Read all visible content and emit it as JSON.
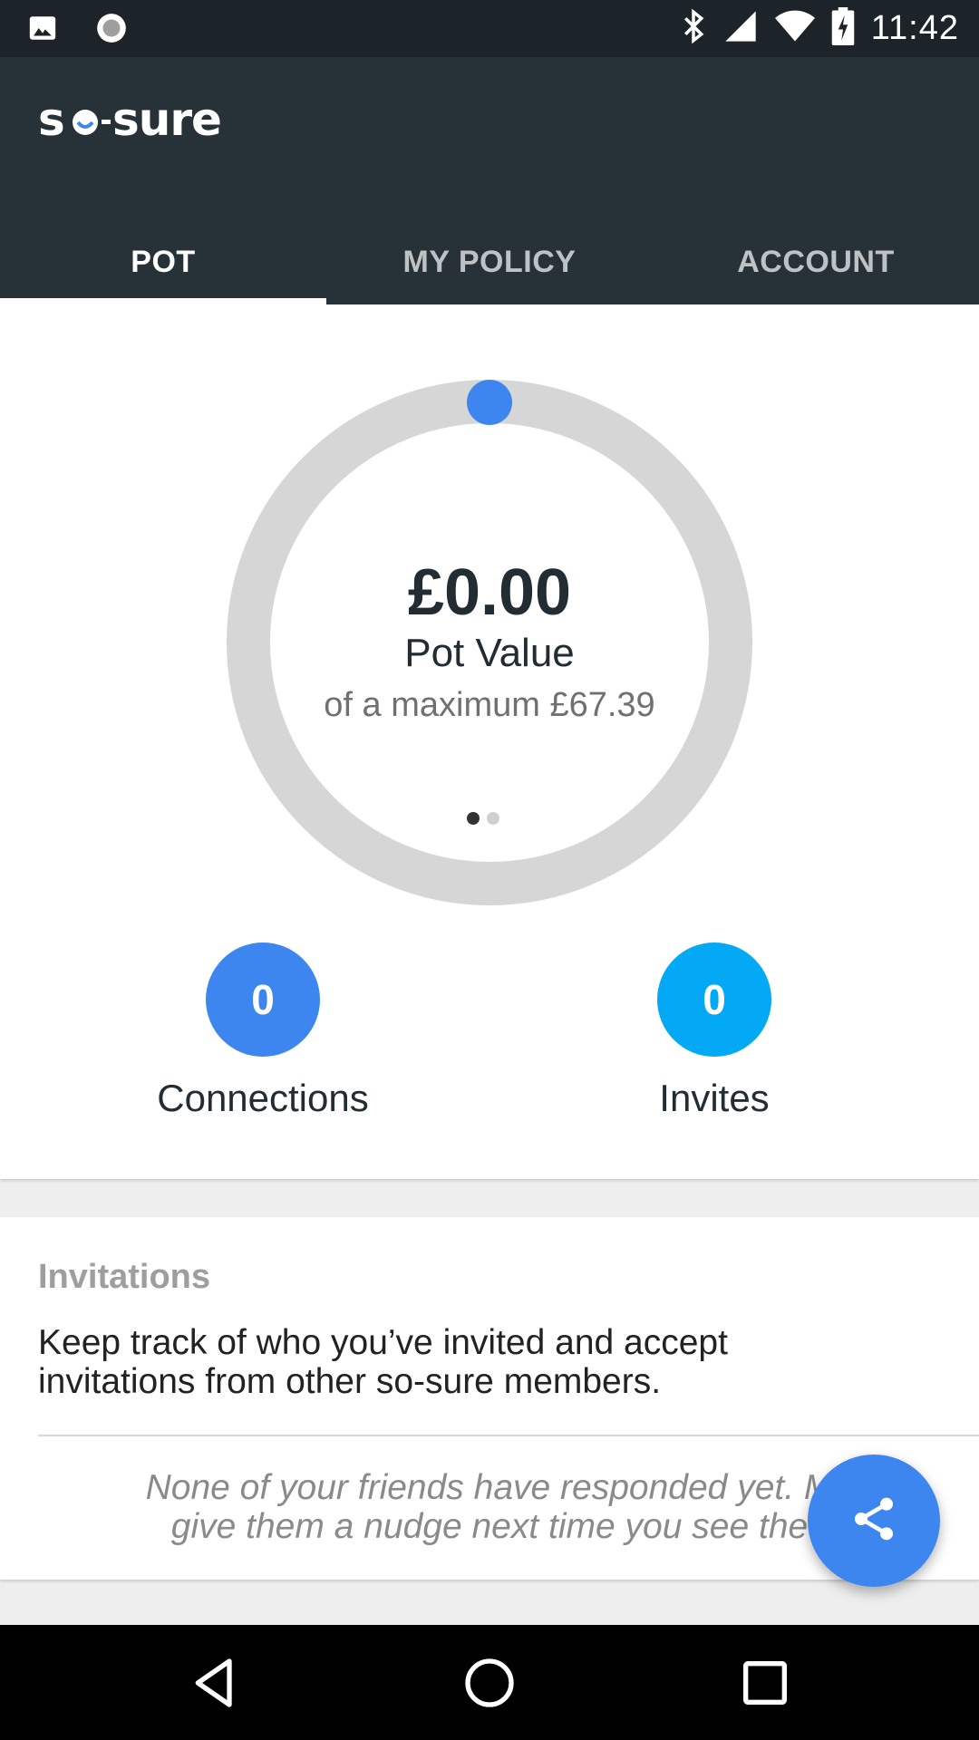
{
  "status_bar": {
    "time": "11:42",
    "icons": [
      "image-icon",
      "record-icon",
      "bluetooth-icon",
      "signal-icon",
      "wifi-icon",
      "battery-charging-icon"
    ]
  },
  "app": {
    "logo_text": "so-sure"
  },
  "tabs": [
    {
      "label": "POT",
      "active": true
    },
    {
      "label": "MY POLICY",
      "active": false
    },
    {
      "label": "ACCOUNT",
      "active": false
    }
  ],
  "pot": {
    "value": "£0.00",
    "label": "Pot Value",
    "maximum_text": "of a maximum £67.39",
    "progress_fraction": 0,
    "pager": {
      "pages": 2,
      "current": 1
    }
  },
  "stats": {
    "connections": {
      "count": "0",
      "label": "Connections"
    },
    "invites": {
      "count": "0",
      "label": "Invites"
    }
  },
  "invitations": {
    "title": "Invitations",
    "description": "Keep track of who you’ve invited and accept invitations from other so-sure members.",
    "empty_message": "None of your friends have responded yet. M\ngive them a nudge next time you see the"
  },
  "colors": {
    "app_bar": "#263238",
    "accent": "#3d86f0",
    "invites_bubble": "#03a9f4",
    "ring_track": "#d6d6d6"
  },
  "fab": {
    "icon": "share-icon"
  },
  "nav_bar": {
    "icons": [
      "back-icon",
      "home-icon",
      "recents-icon"
    ]
  }
}
